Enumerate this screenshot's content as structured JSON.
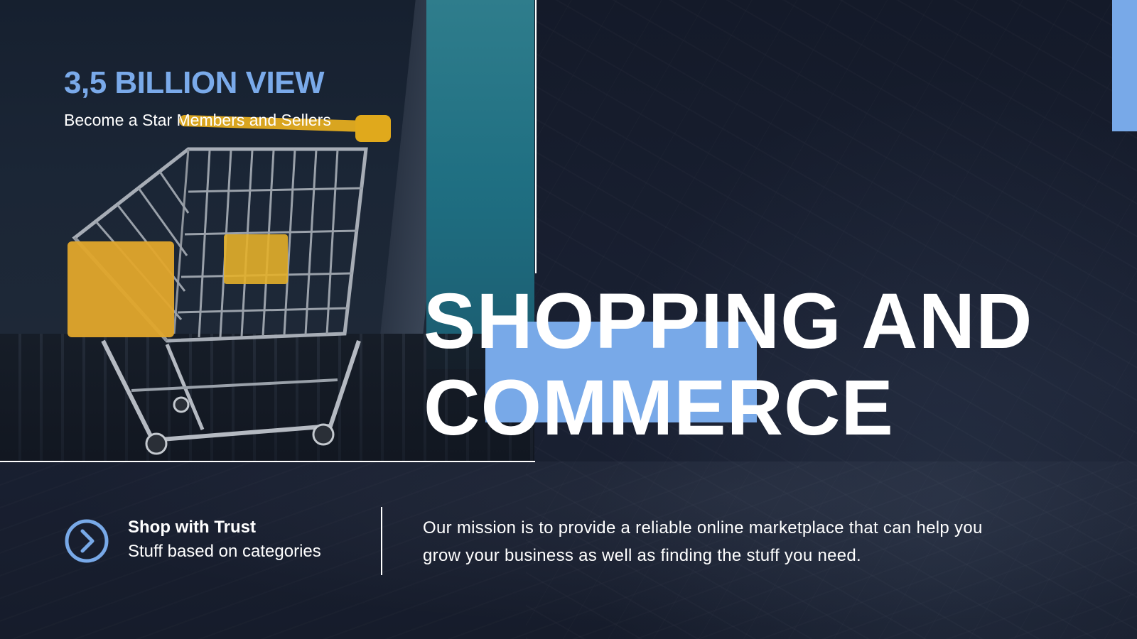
{
  "stat": {
    "title": "3,5 BILLION VIEW",
    "subtitle": "Become a Star Members and Sellers"
  },
  "headline": {
    "line1": "SHOPPING AND",
    "line2": "COMMERCE"
  },
  "feature": {
    "icon": "chevron-right-circle-icon",
    "title": "Shop with Trust",
    "subtitle": "Stuff based on categories"
  },
  "mission": {
    "text": "Our mission is to provide a reliable online marketplace that can help you grow your business as well as finding the stuff you need."
  },
  "colors": {
    "background": "#171d2d",
    "accent": "#78a9e8",
    "text": "#ffffff"
  }
}
